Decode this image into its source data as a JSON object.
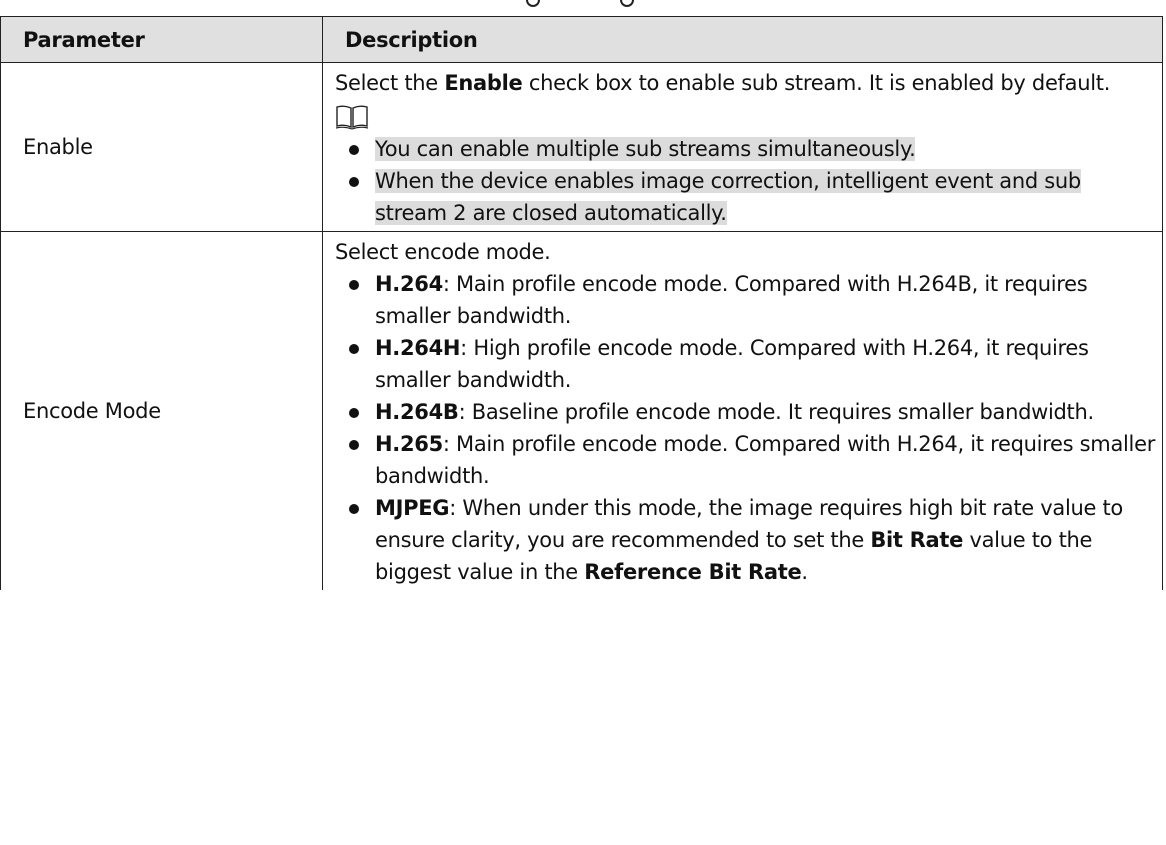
{
  "table": {
    "headers": {
      "parameter": "Parameter",
      "description": "Description"
    },
    "rows": [
      {
        "parameter": "Enable",
        "intro": {
          "before": "Select the ",
          "bold": "Enable",
          "after": " check box to enable sub stream. It is enabled by default."
        },
        "note_icon": "book-note-icon",
        "notes": [
          "You can enable multiple sub streams simultaneously.",
          "When the device enables image correction, intelligent event and sub stream 2 are closed automatically."
        ]
      },
      {
        "parameter": "Encode Mode",
        "intro": "Select encode mode.",
        "bullets": [
          {
            "term": "H.264",
            "text": ": Main profile encode mode. Compared with H.264B, it requires smaller bandwidth."
          },
          {
            "term": "H.264H",
            "text": ": High profile encode mode. Compared with H.264, it requires smaller bandwidth."
          },
          {
            "term": "H.264B",
            "text": ": Baseline profile encode mode. It requires smaller bandwidth."
          },
          {
            "term": "H.265",
            "text": ": Main profile encode mode. Compared with H.264, it requires smaller bandwidth."
          },
          {
            "term": "MJPEG",
            "parts": [
              ": When under this mode, the image requires high bit rate value to ensure clarity, you are recommended to set the ",
              "Bit Rate",
              " value to the biggest value in the ",
              "Reference Bit Rate",
              "."
            ]
          }
        ]
      }
    ]
  }
}
